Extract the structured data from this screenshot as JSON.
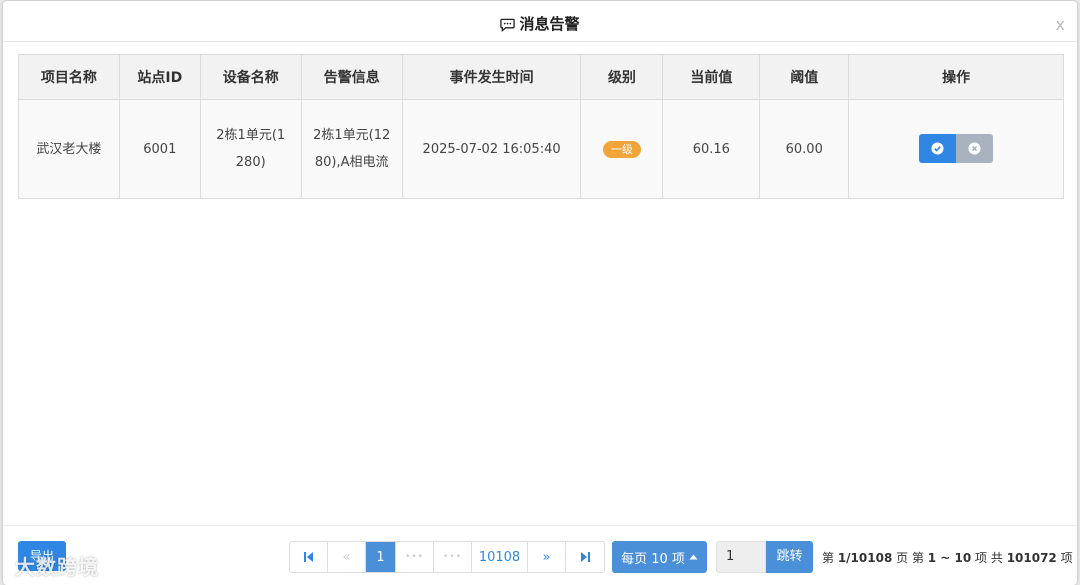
{
  "dialog": {
    "title": "消息告警",
    "close_label": "x"
  },
  "table": {
    "headers": [
      "项目名称",
      "站点ID",
      "设备名称",
      "告警信息",
      "事件发生时间",
      "级别",
      "当前值",
      "阈值",
      "操作"
    ],
    "rows": [
      {
        "project": "武汉老大楼",
        "station_id": "6001",
        "device": "2栋1单元(1280)",
        "alarm": "2栋1单元(1280),A相电流",
        "time": "2025-07-02 16:05:40",
        "level": "一级",
        "current": "60.16",
        "threshold": "60.00"
      }
    ]
  },
  "footer": {
    "export_label": "导出",
    "pager": {
      "first": "first-page-icon",
      "prev": "«",
      "current": "1",
      "ellipsis_left": "•••",
      "ellipsis_right": "•••",
      "last_page": "10108",
      "next": "»",
      "last": "last-page-icon"
    },
    "page_size_label": "每页 10 项",
    "jump_value": "1",
    "jump_label": "跳转",
    "summary": {
      "page_prefix": "第 ",
      "page_value": "1/10108",
      "page_suffix": " 页  第 ",
      "range_value": "1 ~ 10",
      "range_suffix": " 项  共 ",
      "total_value": "101072",
      "total_suffix": " 项"
    }
  },
  "watermark": "大数跨境",
  "colors": {
    "primary": "#2f87e3",
    "pager_active": "#4a90d9",
    "badge": "#f0a43a",
    "cancel": "#a8b3bf"
  }
}
